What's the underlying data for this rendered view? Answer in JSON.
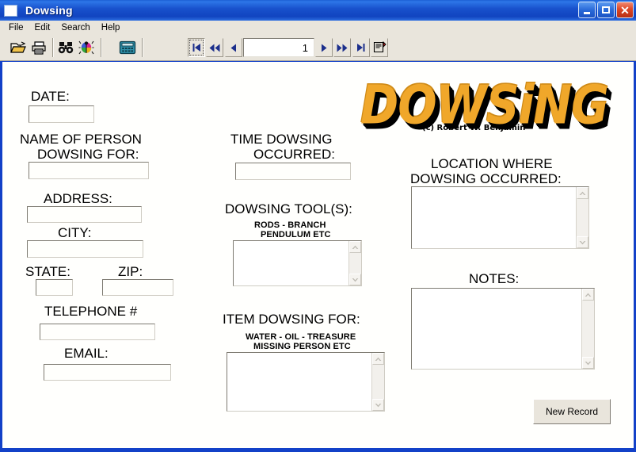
{
  "window": {
    "title": "Dowsing",
    "icon": "document-icon",
    "buttons": {
      "minimize": "minimize-button",
      "maximize": "maximize-button",
      "close": "close-button"
    }
  },
  "menu": {
    "items": [
      "File",
      "Edit",
      "Search",
      "Help"
    ]
  },
  "toolbar": {
    "icons": [
      {
        "name": "open-folder-icon",
        "label": "Open"
      },
      {
        "name": "print-icon",
        "label": "Print"
      },
      {
        "name": "binoculars-icon",
        "label": "Find"
      },
      {
        "name": "ladybug-icon",
        "label": "Bug"
      },
      {
        "name": "calculator-icon",
        "label": "Calculator"
      }
    ],
    "nav": {
      "first": "|<",
      "prev_page": "<<",
      "prev": "<",
      "record_number": "1",
      "next": ">",
      "next_page": ">>",
      "last": ">|",
      "edit": "edit-record-icon"
    }
  },
  "logo": {
    "text": "DOWSiNG",
    "copyright": "(c) Robert W. Benjamin",
    "color": "#f0a72a",
    "shadow_color": "#000000"
  },
  "form": {
    "date": {
      "label": "DATE:",
      "value": ""
    },
    "name": {
      "label_line1": "NAME OF PERSON",
      "label_line2": "DOWSING FOR:",
      "value": ""
    },
    "address": {
      "label": "ADDRESS:",
      "value": ""
    },
    "city": {
      "label": "CITY:",
      "value": ""
    },
    "state": {
      "label": "STATE:",
      "value": ""
    },
    "zip": {
      "label": "ZIP:",
      "value": ""
    },
    "telephone": {
      "label": "TELEPHONE #",
      "value": ""
    },
    "email": {
      "label": "EMAIL:",
      "value": ""
    },
    "time": {
      "label_line1": "TIME DOWSING",
      "label_line2": "OCCURRED:",
      "value": ""
    },
    "tools": {
      "label": "DOWSING TOOL(S):",
      "hint_line1": "RODS - BRANCH",
      "hint_line2": "PENDULUM ETC",
      "value": ""
    },
    "item": {
      "label": "ITEM DOWSING FOR:",
      "hint_line1": "WATER - OIL - TREASURE",
      "hint_line2": "MISSING PERSON ETC",
      "value": ""
    },
    "location": {
      "label_line1": "LOCATION WHERE",
      "label_line2": "DOWSING OCCURRED:",
      "value": ""
    },
    "notes": {
      "label": "NOTES:",
      "value": ""
    },
    "new_record_button": "New Record"
  }
}
